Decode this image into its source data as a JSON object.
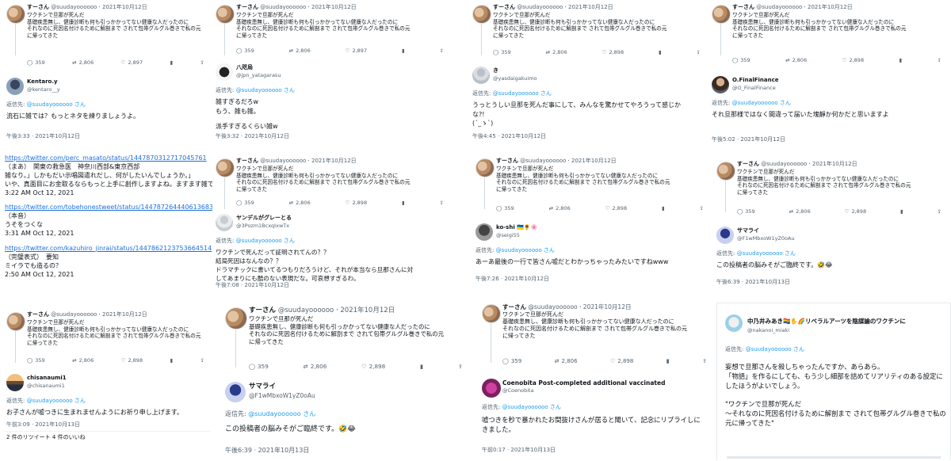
{
  "quoted": {
    "name": "すーさん",
    "handle": "@suudayoooooo",
    "date": "2021年10月12日",
    "lines": [
      "ワクチンで旦那が死んだ",
      "基礎疾患無し、健康診断も何も引っかかってない健康な人だったのに",
      "それなのに死因名付けるために解剖まで されて包帯グルグル巻きで私の元",
      "に帰ってきた"
    ],
    "replies": "359",
    "retweets_a": "2,806",
    "likes_a": "2,897",
    "likes_b": "2,898"
  },
  "reply_to_label": "返信先:",
  "reply_to_handle": "@suudayoooooo さん",
  "cards": [
    {
      "id": "kentaro",
      "name": "Kentaro.y",
      "handle": "@kentaro__y",
      "text": [
        "流石に雑では？もっとネタを練りましょうよ。"
      ],
      "time": "午後3:33 · 2021年10月12日"
    },
    {
      "id": "yatagarasu",
      "name": "八咫烏",
      "handle": "@jpn_yatagarasu",
      "text": [
        "雑すぎるだろw",
        "もう、雑も雑。",
        "",
        "派手すぎるくらい雑w"
      ],
      "time": "午後3:32 · 2021年10月12日"
    },
    {
      "id": "ki",
      "name": "き",
      "handle": "@yasdaigakuimo",
      "text": [
        "うっとうしい旦那を死んだ事にして、みんなを驚かせてやろうって感じか",
        "な?!",
        "(´_ゝ`)"
      ],
      "time": "午後4:45 · 2021年10月12日"
    },
    {
      "id": "finalfinance",
      "name": "O.FinalFinance",
      "handle": "@O_FinalFinance",
      "text": [
        "それ旦那様ではなく間違って届いた塊靜か何かだと思いますよ"
      ],
      "time": "午後5:02 · 2021年10月12日"
    },
    {
      "id": "yanderu",
      "name": "ヤンデルがグレーとる",
      "handle": "@3Pozm1BcxqIxwTx",
      "text": [
        "ワクチンで死んだって証明されてんの？？",
        "結局死因はなんなの？？",
        "ドラマチックに書いてるつもりだろうけど、それが本当なら旦那さんに対",
        "してあまりにも酷のない表現だな。可哀想すぎるわ。"
      ],
      "time": "午後7:08 · 2021年10月12日"
    },
    {
      "id": "koshi",
      "name": "ko-shi 🇺🇦🌻🌸",
      "handle": "@seigi55",
      "text": [
        "あーあ最後の一行で皆さん嘘だとわかっちゃったみたいですねwww"
      ],
      "time": "午後7:26 · 2021年10月12日"
    },
    {
      "id": "samurai_s",
      "name": "サマライ",
      "handle": "@F1wMbxoW1yZ0oAu",
      "text": [
        "この投稿者の脳みそがご臨終です。🤣😂"
      ],
      "time": "午後6:39 · 2021年10月13日"
    },
    {
      "id": "chisanaumi",
      "name": "chisanaumi1",
      "handle": "@chisanaumi1",
      "text": [
        "お子さんが嘘つきに生まれませんようにお祈り申し上げます。"
      ],
      "time": "午前3:09 · 2021年10月13日",
      "stats": "2 件のリツイート    4 件のいいね"
    },
    {
      "id": "samurai_b",
      "name": "サマライ",
      "handle": "@F1wMbxoW1yZ0oAu",
      "text": [
        "この投稿者の脳みそがご臨終です。🤣😂"
      ],
      "time": "午後6:39 · 2021年10月13日"
    },
    {
      "id": "coenobita",
      "name": "Coenobita Post-completed additional vaccinated",
      "handle": "@Coenobita",
      "text": [
        "嘘つきを秒で暴かれたお間抜けさんが居ると聞いて、記念にリプライしに",
        "きました。"
      ],
      "time": "午前0:17 · 2021年10月13日"
    },
    {
      "id": "nakanoi",
      "name": "中乃井みあき🏳️‍🌈✋🌈リベラルアーツを陰謀論のワクチンに",
      "handle": "@nakanoi_miaki",
      "text": [
        "妄想で旦那さんを殺しちゃったんですか、あらあら。",
        "「物語」を作るにしても、もう少し細部を詰めてリアリティのある設定に",
        "したほうがよいでしょう。",
        "",
        "\"ワクチンで旦那が死んだ",
        "〜それなのに死因名付けるために解剖まで されて包帯グルグル巻きで私の",
        "元に帰ってきた\""
      ],
      "time": ""
    }
  ],
  "links": [
    {
      "url": "https://twitter.com/perc_masato/status/1447870312717045761",
      "lines": [
        "（まあ）　関東の救急医　神奈川西部&東京西部",
        "雑なり。」しかもだい示唱図遣れだし、何がしたいんでしょうか。」",
        "いや、真面目にお金取るならもっと上手に創作しますよね。ますます雑です"
      ],
      "time": "3:22 AM Oct 12, 2021"
    },
    {
      "url": "https://twitter.com/tobehonestweet/status/1447872644406136838",
      "lines": [
        "（本音）",
        "うそをつくな"
      ],
      "time": "3:31 AM Oct 12, 2021"
    },
    {
      "url": "https://twitter.com/kazuhiro_jinrai/status/1447862123753664514",
      "lines": [
        "（完璧表式）　要知",
        "ミイラでも造るの？"
      ],
      "time": "2:50 AM Oct 12, 2021"
    }
  ]
}
